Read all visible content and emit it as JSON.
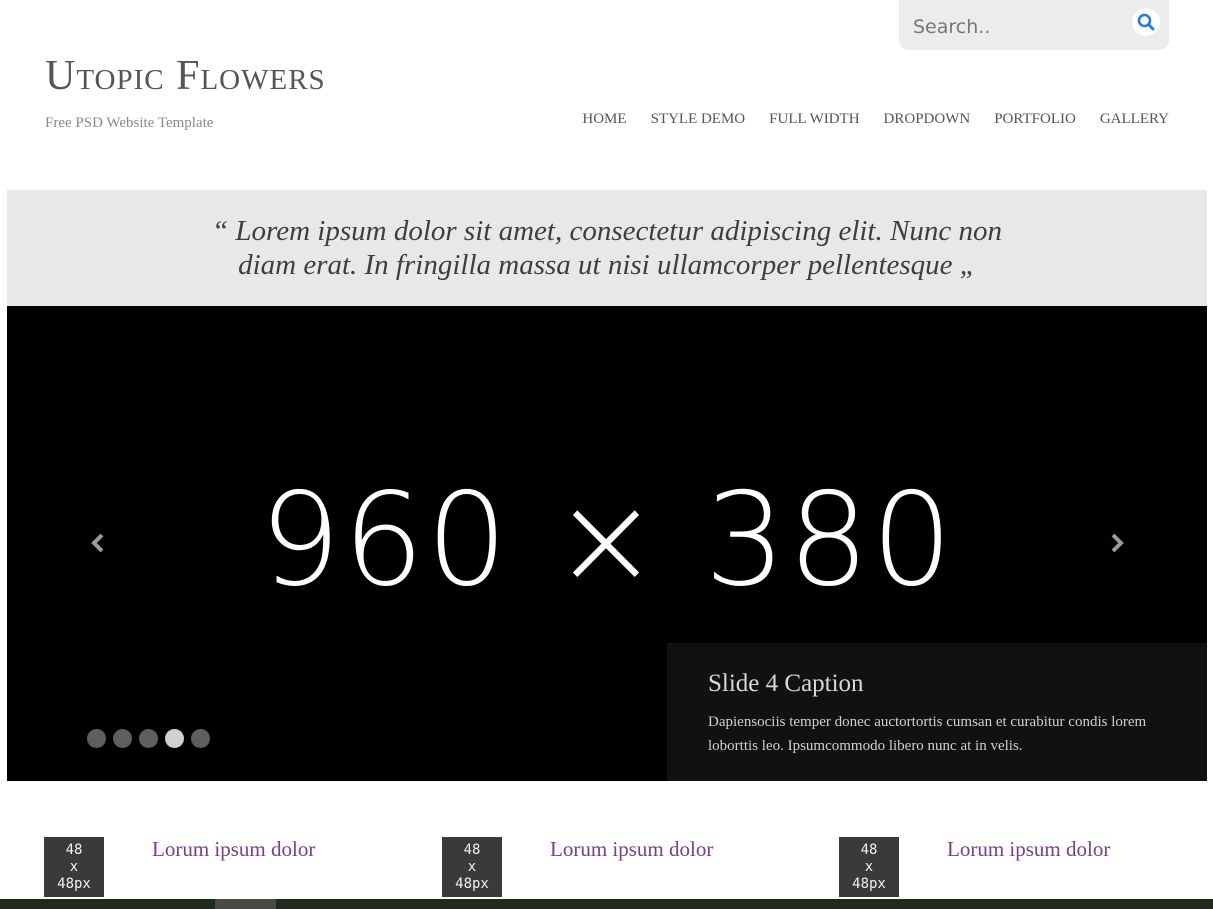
{
  "search": {
    "placeholder": "Search..",
    "value": ""
  },
  "brand": {
    "title": "Utopic Flowers",
    "subtitle": "Free PSD Website Template"
  },
  "nav": {
    "items": [
      "HOME",
      "STYLE DEMO",
      "FULL WIDTH",
      "DROPDOWN",
      "PORTFOLIO",
      "GALLERY"
    ]
  },
  "quote": {
    "text": "“ Lorem ipsum dolor sit amet, consectetur adipiscing elit. Nunc non diam erat. In fringilla massa ut nisi ullamcorper pellentesque „"
  },
  "slider": {
    "placeholder": "960 × 380",
    "caption_title": "Slide 4 Caption",
    "caption_text": "Dapiensociis temper donec auctortortis cumsan et curabitur condis lorem loborttis leo. Ipsumcommodo libero nunc at in velis.",
    "slide_count": 5,
    "active_slide": 4
  },
  "features": [
    {
      "thumb": [
        "48",
        "x",
        "48px"
      ],
      "title": "Lorum ipsum dolor"
    },
    {
      "thumb": [
        "48",
        "x",
        "48px"
      ],
      "title": "Lorum ipsum dolor"
    },
    {
      "thumb": [
        "48",
        "x",
        "48px"
      ],
      "title": "Lorum ipsum dolor"
    }
  ],
  "icons": {
    "search": "search-icon",
    "prev": "chevron-left-icon",
    "next": "chevron-right-icon"
  },
  "colors": {
    "accent": "#7a3d8c",
    "search_icon": "#2a7ad8",
    "slider_bg": "#000000",
    "quote_bg": "#e8e8e8"
  }
}
